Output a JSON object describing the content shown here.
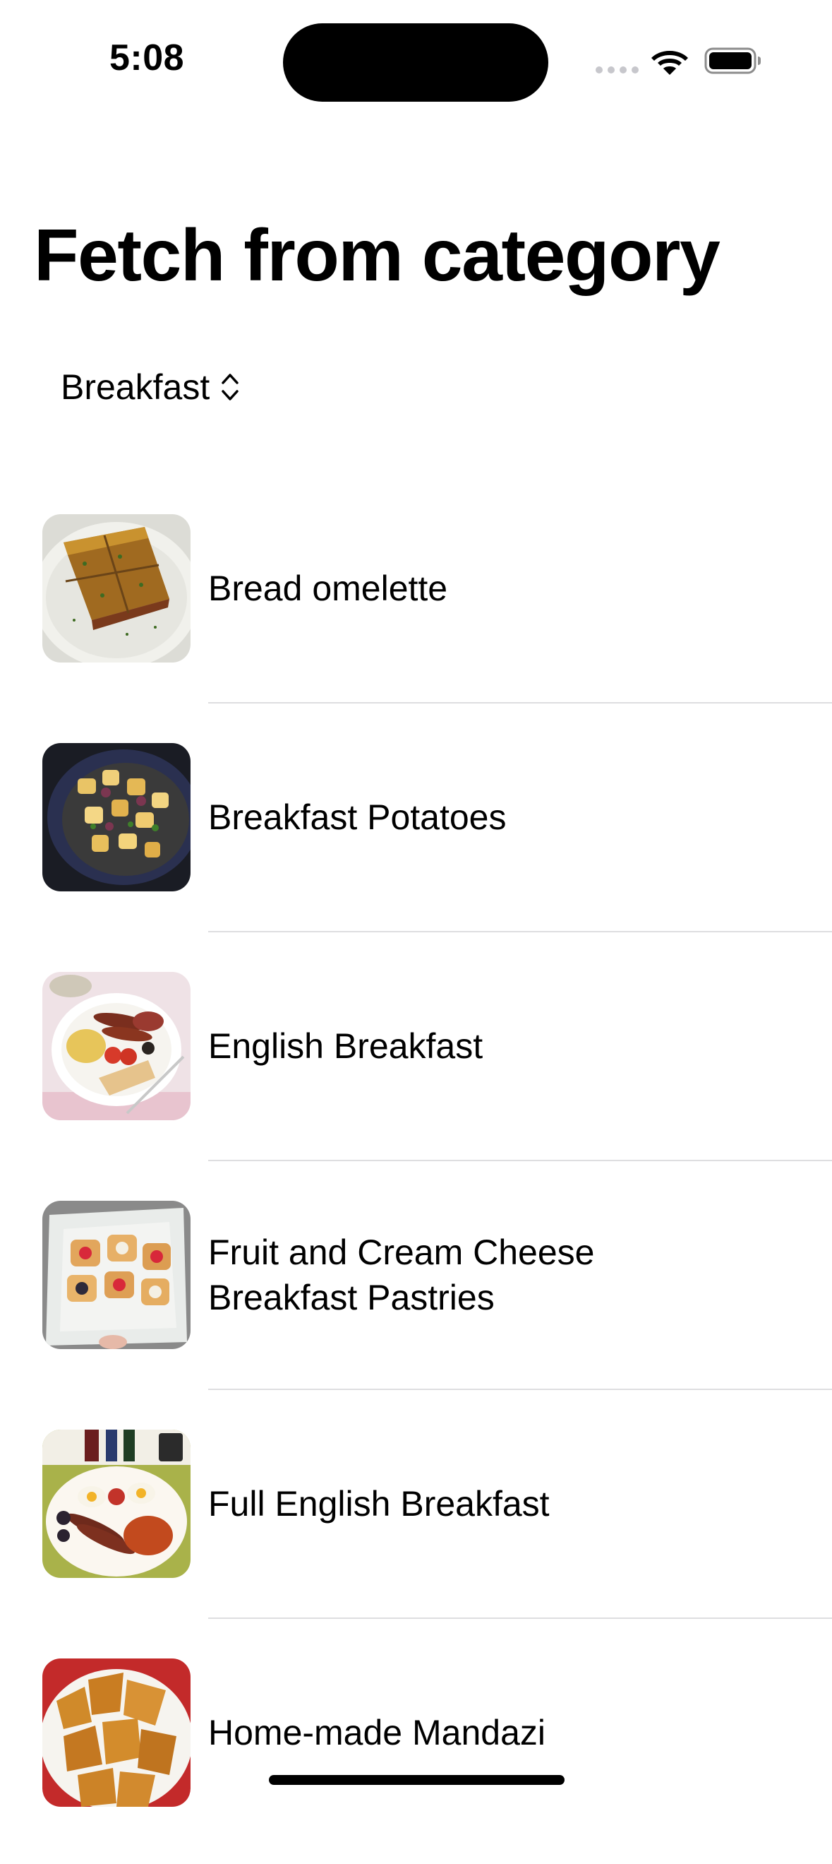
{
  "status_bar": {
    "time": "5:08",
    "icons": [
      "cellular-signal-icon",
      "wifi-icon",
      "battery-icon"
    ]
  },
  "page": {
    "title": "Fetch from category"
  },
  "picker": {
    "selected": "Breakfast",
    "icon": "chevron-up-down-icon"
  },
  "meals": [
    {
      "name": "Bread omelette",
      "thumbnail": "bread-omelette-photo"
    },
    {
      "name": "Breakfast Potatoes",
      "thumbnail": "breakfast-potatoes-photo"
    },
    {
      "name": "English Breakfast",
      "thumbnail": "english-breakfast-photo"
    },
    {
      "name": "Fruit and Cream Cheese Breakfast Pastries",
      "thumbnail": "fruit-cream-cheese-pastries-photo"
    },
    {
      "name": "Full English Breakfast",
      "thumbnail": "full-english-breakfast-photo"
    },
    {
      "name": "Home-made Mandazi",
      "thumbnail": "home-made-mandazi-photo"
    }
  ],
  "colors": {
    "text": "#000000",
    "background": "#ffffff",
    "divider": "#dedee0",
    "signal_inactive": "#c7c7cc"
  }
}
